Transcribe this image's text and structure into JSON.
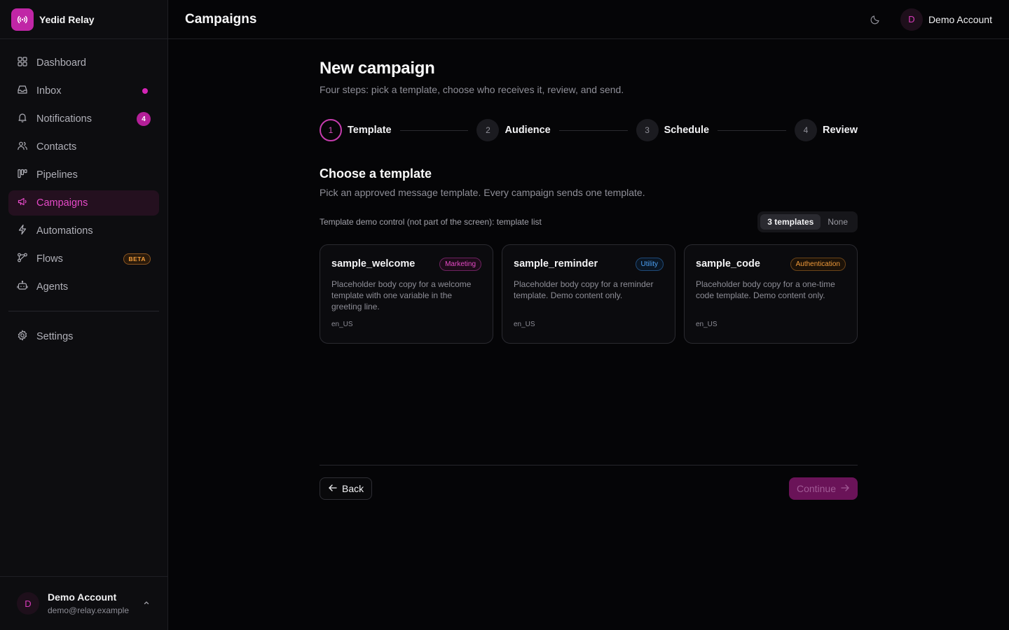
{
  "brand": {
    "name": "Yedid Relay"
  },
  "sidebar": {
    "items": [
      {
        "label": "Dashboard",
        "icon": "grid-icon"
      },
      {
        "label": "Inbox",
        "icon": "inbox-icon",
        "indicator": "dot"
      },
      {
        "label": "Notifications",
        "icon": "bell-icon",
        "count": "4"
      },
      {
        "label": "Contacts",
        "icon": "users-icon"
      },
      {
        "label": "Pipelines",
        "icon": "kanban-icon"
      },
      {
        "label": "Campaigns",
        "icon": "megaphone-icon",
        "active": true
      },
      {
        "label": "Automations",
        "icon": "bolt-icon"
      },
      {
        "label": "Flows",
        "icon": "workflow-icon",
        "badge": "BETA"
      },
      {
        "label": "Agents",
        "icon": "bot-icon"
      }
    ],
    "settings_label": "Settings",
    "account": {
      "initial": "D",
      "name": "Demo Account",
      "email": "demo@relay.example"
    }
  },
  "header": {
    "title": "Campaigns",
    "user": {
      "initial": "D",
      "name": "Demo Account"
    }
  },
  "main": {
    "title": "New campaign",
    "subtitle": "Four steps: pick a template, choose who receives it, review, and send.",
    "steps": [
      {
        "number": "1",
        "label": "Template",
        "active": true
      },
      {
        "number": "2",
        "label": "Audience"
      },
      {
        "number": "3",
        "label": "Schedule"
      },
      {
        "number": "4",
        "label": "Review"
      }
    ],
    "section_title": "Choose a template",
    "section_subtitle": "Pick an approved message template. Every campaign sends one template.",
    "demo_control": {
      "text": "Template demo control (not part of the screen): template list",
      "options": [
        "3 templates",
        "None"
      ],
      "selected": "3 templates"
    },
    "templates": [
      {
        "name": "sample_welcome",
        "category": "Marketing",
        "body": "Placeholder body copy for a welcome template with one variable in the greeting line.",
        "locale": "en_US"
      },
      {
        "name": "sample_reminder",
        "category": "Utility",
        "body": "Placeholder body copy for a reminder template. Demo content only.",
        "locale": "en_US"
      },
      {
        "name": "sample_code",
        "category": "Authentication",
        "body": "Placeholder body copy for a one-time code template. Demo content only.",
        "locale": "en_US"
      }
    ],
    "back_label": "Back",
    "continue_label": "Continue"
  },
  "colors": {
    "accent": "#c026a6",
    "background": "#050507",
    "sidebar": "#0d0d10"
  }
}
